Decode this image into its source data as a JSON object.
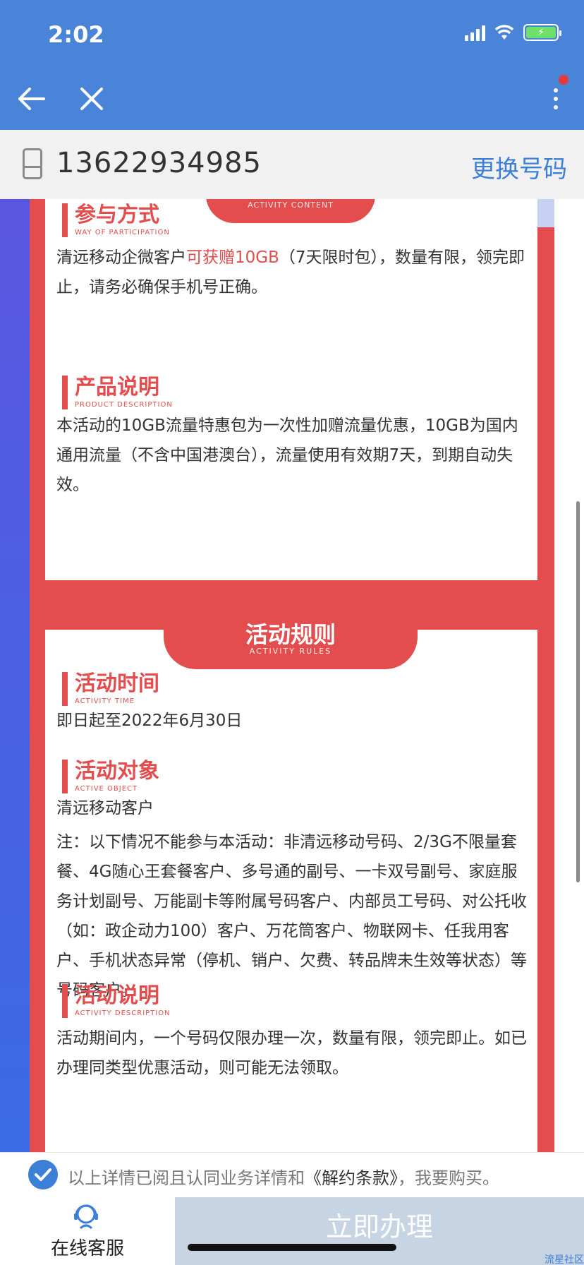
{
  "status": {
    "time": "2:02"
  },
  "account": {
    "phone": "13622934985",
    "change_label": "更换号码"
  },
  "sections": {
    "top_tab_en": "ACTIVITY CONTENT",
    "participation": {
      "title": "参与方式",
      "title_en": "WAY OF PARTICIPATION",
      "text_before": "清远移动企微客户",
      "text_highlight": "可获赠10GB",
      "text_after": "（7天限时包），数量有限，领完即止，请务必确保手机号正确。"
    },
    "product": {
      "title": "产品说明",
      "title_en": "PRODUCT DESCRIPTION",
      "text": "本活动的10GB流量特惠包为一次性加赠流量优惠，10GB为国内通用流量（不含中国港澳台），流量使用有效期7天，到期自动失效。"
    },
    "rules_tab": {
      "title": "活动规则",
      "title_en": "ACTIVITY RULES"
    },
    "time": {
      "title": "活动时间",
      "title_en": "ACTIVITY TIME",
      "text": "即日起至2022年6月30日"
    },
    "object": {
      "title": "活动对象",
      "title_en": "ACTIVE OBJECT",
      "text": "清远移动客户",
      "note": "注：以下情况不能参与本活动：非清远移动号码、2/3G不限量套餐、4G随心王套餐客户、多号通的副号、一卡双号副号、家庭服务计划副号、万能副卡等附属号码客户、内部员工号码、对公托收（如：政企动力100）客户、万花筒客户、物联网卡、任我用客户、手机状态异常（停机、销户、欠费、转品牌未生效等状态）等号码客户。"
    },
    "desc": {
      "title": "活动说明",
      "title_en": "ACTIVITY DESCRIPTION",
      "text": "活动期间内，一个号码仅限办理一次，数量有限，领完即止。如已办理同类型优惠活动，则可能无法领取。"
    }
  },
  "agreement": {
    "text_before": "以上详情已阅且认同业务详情和",
    "link": "《解约条款》",
    "text_after": "，我要购买。"
  },
  "bottom": {
    "service_label": "在线客服",
    "apply_label": "立即办理"
  },
  "watermark": "流星社区",
  "colors": {
    "primary_blue": "#4a84d8",
    "activity_red": "#e34d4d",
    "button_disabled": "#c7d4e3"
  }
}
